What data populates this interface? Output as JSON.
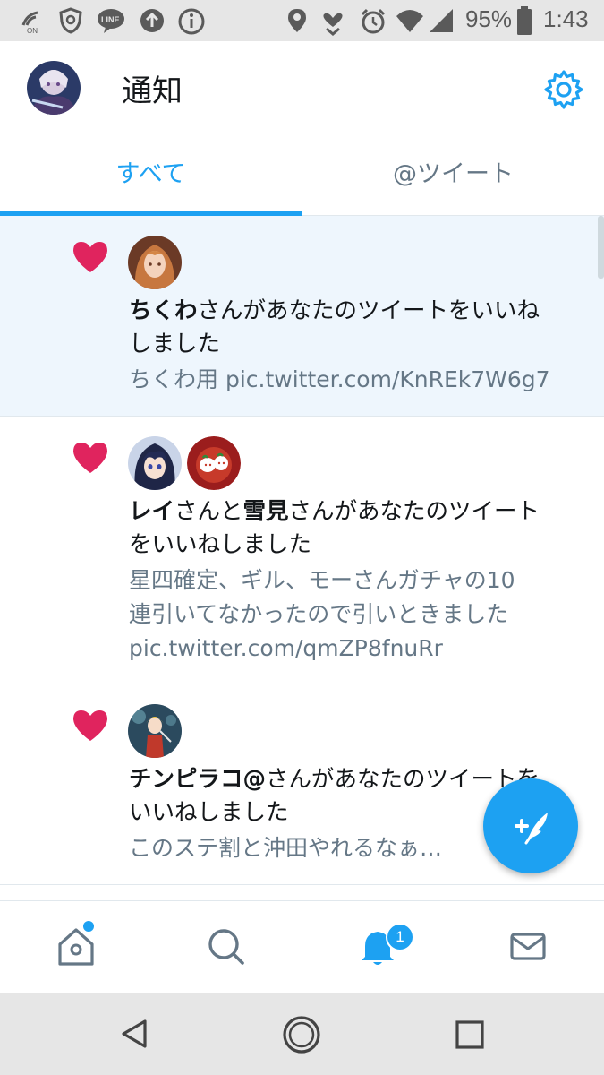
{
  "status_bar": {
    "battery": "95%",
    "time": "1:43",
    "icons": [
      "wifi-call-icon",
      "shield-icon",
      "line-icon",
      "upload-icon",
      "info-icon",
      "location-icon",
      "heart-hand-icon",
      "alarm-icon",
      "signal-icon",
      "battery-icon"
    ]
  },
  "header": {
    "title": "通知",
    "settings_icon": "gear-icon"
  },
  "tabs": [
    {
      "label": "すべて",
      "active": true
    },
    {
      "label": "@ツイート",
      "active": false
    }
  ],
  "notifications": [
    {
      "actors": [
        "ちくわ"
      ],
      "action": "さんがあなたのツイートをいいね",
      "action_line2": "しました",
      "tweet_lines": [
        "ちくわ用 pic.twitter.com/KnREk7W6g7"
      ],
      "unread": true
    },
    {
      "actors": [
        "レイ",
        "雪見"
      ],
      "joiner": "さんと",
      "action": "さんがあなたのツイート",
      "action_line2": "をいいねしました",
      "tweet_lines": [
        "星四確定、ギル、モーさんガチャの10",
        "連引いてなかったので引いときました",
        "pic.twitter.com/qmZP8fnuRr"
      ],
      "unread": false
    },
    {
      "actors": [
        "チンピラコ@"
      ],
      "action": "さんがあなたのツイートを",
      "action_line2": "いいねしました",
      "tweet_lines": [
        "このステ割と沖田やれるなぁ…"
      ],
      "unread": false
    }
  ],
  "bottom_nav": {
    "items": [
      "home-icon",
      "search-icon",
      "notifications-icon",
      "messages-icon"
    ],
    "notification_badge": "1"
  },
  "colors": {
    "accent": "#1da1f2",
    "heart": "#e0245e",
    "secondary_text": "#657786",
    "unread_bg": "#eef6fd"
  }
}
